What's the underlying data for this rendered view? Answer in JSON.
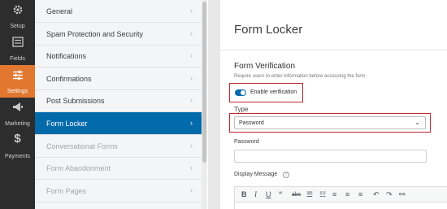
{
  "rail": {
    "setup": "Setup",
    "fields": "Fields",
    "settings": "Settings",
    "marketing": "Marketing",
    "payments": "Payments",
    "active": "settings"
  },
  "submenu": {
    "items": [
      {
        "label": "General"
      },
      {
        "label": "Spam Protection and Security"
      },
      {
        "label": "Notifications"
      },
      {
        "label": "Confirmations"
      },
      {
        "label": "Post Submissions"
      },
      {
        "label": "Form Locker"
      },
      {
        "label": "Conversational Forms"
      },
      {
        "label": "Form Abandonment"
      },
      {
        "label": "Form Pages"
      }
    ],
    "active_item": "Form Locker"
  },
  "panel": {
    "title": "Form Locker",
    "section_title": "Form Verification",
    "section_desc": "Require users to enter information before accessing the form.",
    "toggle_label": "Enable verification",
    "type_label": "Type",
    "type_value": "Password",
    "password_label": "Password",
    "password_value": "",
    "display_message_label": "Display Message"
  },
  "colors": {
    "accent": "#036aab",
    "active_rail": "#e27730",
    "highlight": "#c2272d"
  }
}
